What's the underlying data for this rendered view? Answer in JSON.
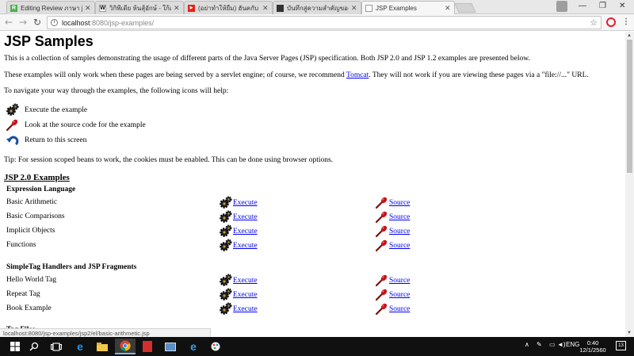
{
  "browser": {
    "tabs": [
      {
        "title": "Editing Review ภาษา jsp",
        "favicon_text": "R",
        "favicon_color": "#4caf50",
        "active": false
      },
      {
        "title": "วิกิพีเดีย ห้นสุ้อักษ์ - ใก้เห้นมิม",
        "favicon_text": "W",
        "favicon_color": "#ffffff",
        "active": false
      },
      {
        "title": "(อย่าทำให้ยืม) ฮันคกับ - ถือ",
        "favicon_text": "▶",
        "favicon_color": "#e62117",
        "active": false
      },
      {
        "title": "บันทึกสู่ความสำคัญของทางมีว",
        "favicon_text": "",
        "favicon_color": "#333333",
        "active": false
      },
      {
        "title": "JSP Examples",
        "favicon_text": "",
        "favicon_color": "#ffffff",
        "active": true
      }
    ],
    "window_controls": {
      "minimize": "—",
      "maximize": "❐",
      "close": "✕"
    },
    "url_host": "localhost",
    "url_path": ":8080/jsp-examples/",
    "status_url": "localhost:8080/jsp-examples/jsp2/el/basic-arithmetic.jsp",
    "colors": {
      "opera": "#e0202a",
      "link": "#0000ee"
    }
  },
  "page": {
    "title": "JSP Samples",
    "intro": "This is a collection of samples demonstrating the usage of different parts of the Java Server Pages (JSP) specification. Both JSP 2.0 and JSP 1.2 examples are presented below.",
    "servlet_pre": "These examples will only work when these pages are being served by a servlet engine; of course, we recommend ",
    "servlet_link": "Tomcat",
    "servlet_post": ". They will not work if you are viewing these pages via a \"file://...\" URL.",
    "nav_intro": "To navigate your way through the examples, the following icons will help:",
    "legend": [
      {
        "icon": "execute-icon",
        "text": "Execute the example"
      },
      {
        "icon": "source-icon",
        "text": "Look at the source code for the example"
      },
      {
        "icon": "return-icon",
        "text": "Return to this screen"
      }
    ],
    "tip": "Tip: For session scoped beans to work, the cookies must be enabled. This can be done using browser options.",
    "section_title": "JSP 2.0 Examples",
    "groups": [
      {
        "title": "Expression Language",
        "rows": [
          {
            "name": "Basic Arithmetic",
            "exec": "Execute",
            "source": "Source"
          },
          {
            "name": "Basic Comparisons",
            "exec": "Execute",
            "source": "Source"
          },
          {
            "name": "Implicit Objects",
            "exec": "Execute",
            "source": "Source"
          },
          {
            "name": "Functions",
            "exec": "Execute",
            "source": "Source"
          }
        ]
      },
      {
        "title": "SimpleTag Handlers and JSP Fragments",
        "rows": [
          {
            "name": "Hello World Tag",
            "exec": "Execute",
            "source": "Source"
          },
          {
            "name": "Repeat Tag",
            "exec": "Execute",
            "source": "Source"
          },
          {
            "name": "Book Example",
            "exec": "Execute",
            "source": "Source"
          }
        ]
      },
      {
        "title": "Tag Files",
        "rows": []
      }
    ]
  },
  "taskbar": {
    "lang": "ENG",
    "time": "0:40",
    "date": "12/1/2560",
    "notifications": "13"
  }
}
